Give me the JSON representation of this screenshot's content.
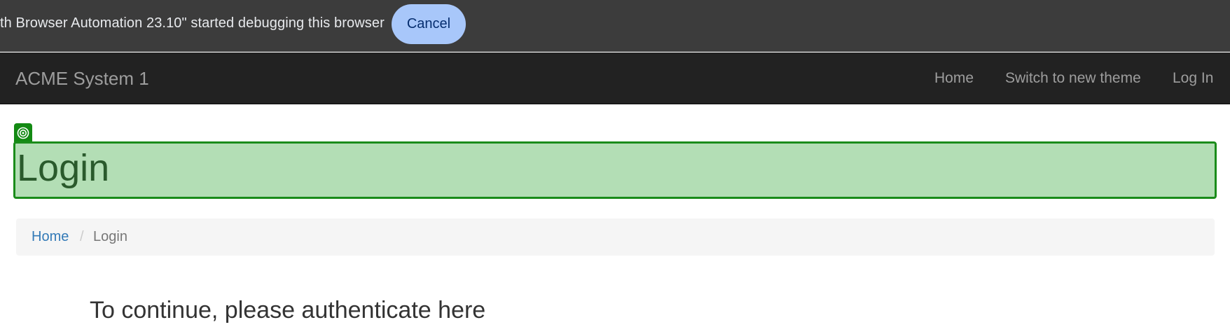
{
  "infobar": {
    "message": "th Browser Automation 23.10\" started debugging this browser",
    "cancel_label": "Cancel"
  },
  "navbar": {
    "brand": "ACME System 1",
    "links": [
      "Home",
      "Switch to new theme",
      "Log In"
    ]
  },
  "page": {
    "title": "Login",
    "breadcrumb": {
      "home": "Home",
      "separator": "/",
      "current": "Login"
    },
    "auth_heading": "To continue, please authenticate here"
  },
  "colors": {
    "infobar_bg": "#3c3c3c",
    "cancel_button_bg": "#a8c7fa",
    "navbar_bg": "#222222",
    "highlight_bg": "#b3deb5",
    "highlight_border": "#1a8c1a",
    "link": "#337ab7"
  }
}
